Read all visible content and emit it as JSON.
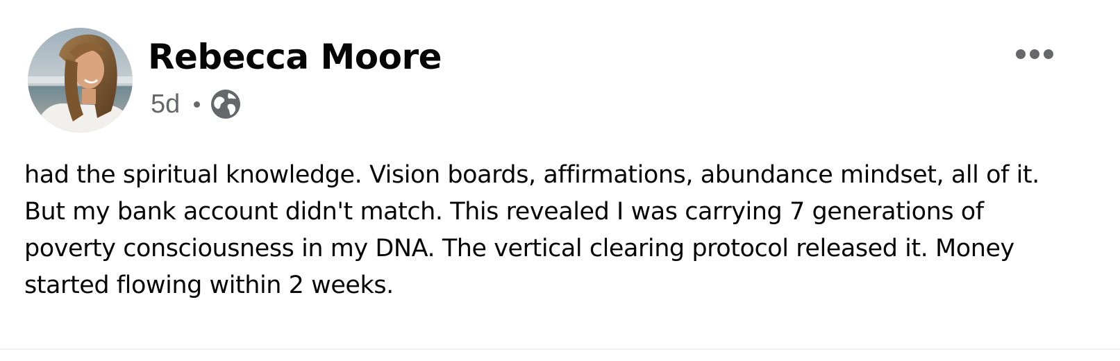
{
  "post": {
    "author": {
      "name": "Rebecca Moore",
      "avatar_icon": "profile-photo"
    },
    "meta": {
      "time": "5d",
      "separator": "•",
      "audience_icon": "globe-icon"
    },
    "more_icon": "more-options-icon",
    "body": "had the spiritual knowledge. Vision boards, affirmations, abundance mindset, all of it. But my bank account didn't match. This revealed I was carrying 7 generations of poverty consciousness in my DNA. The vertical clearing protocol released it. Money started flowing within 2 weeks."
  },
  "colors": {
    "name_text": "#050505",
    "secondary_text": "#65676b",
    "background": "#ffffff"
  }
}
